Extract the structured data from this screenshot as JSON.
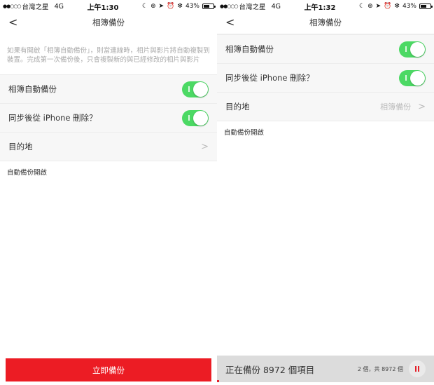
{
  "screens": [
    {
      "status": {
        "carrier": "台灣之星",
        "network": "4G",
        "time": "上午1:30",
        "battery": "43%",
        "battery_level": 0.43
      },
      "navbar": {
        "back": "<",
        "title": "相簿備份"
      },
      "description": "如果有開啟「相簿自動備份」，則當連線時，相片與影片將自動複製到裝置。完成第一次備份後，只會複製新的與已經修改的相片與影片",
      "rows": [
        {
          "label": "相簿自動備份",
          "type": "toggle",
          "on": true
        },
        {
          "label": "同步後從 iPhone 刪除？",
          "type": "toggle",
          "on": true
        },
        {
          "label": "目的地",
          "type": "link",
          "value": "",
          "chevron": ">"
        }
      ],
      "footnote": "自動備份開啟",
      "action_button": "立即備份"
    },
    {
      "status": {
        "carrier": "台灣之星",
        "network": "4G",
        "time": "上午1:32",
        "battery": "43%",
        "battery_level": 0.43
      },
      "navbar": {
        "back": "<",
        "title": "相簿備份"
      },
      "rows": [
        {
          "label": "相簿自動備份",
          "type": "toggle",
          "on": true
        },
        {
          "label": "同步後從 iPhone 刪除？",
          "type": "toggle",
          "on": true
        },
        {
          "label": "目的地",
          "type": "link",
          "value": "相簿備份",
          "chevron": ">"
        }
      ],
      "footnote": "自動備份開啟",
      "progress": {
        "text": "正在備份 8972 個項目",
        "count": "2 個，共 8972 個",
        "done": 2,
        "total": 8972,
        "accent": "#e5202a"
      }
    }
  ],
  "colors": {
    "toggle_on": "#4cd964",
    "primary": "#ec1c24"
  }
}
